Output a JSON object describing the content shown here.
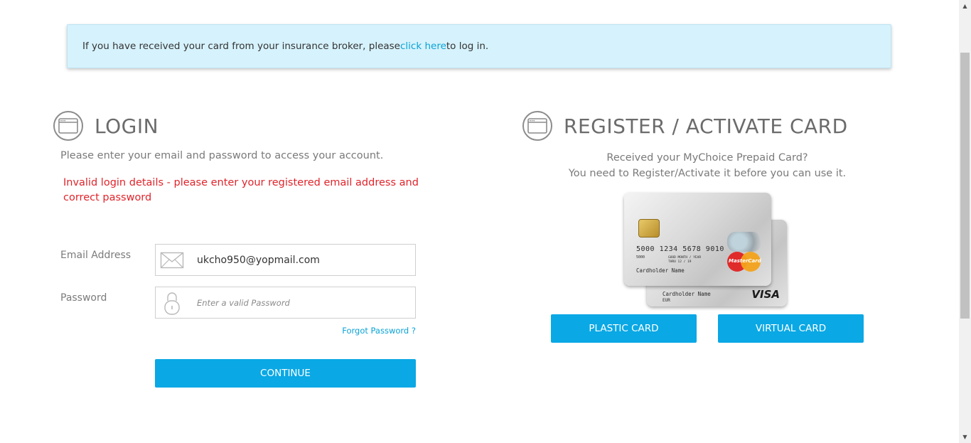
{
  "notice": {
    "before": "If you have received your card from your insurance broker, please ",
    "link": "click here",
    "after": " to log in."
  },
  "login": {
    "title": "LOGIN",
    "intro": "Please enter your email and password to access your account.",
    "error": "Invalid login details - please enter your registered email address and correct password",
    "email_label": "Email Address",
    "email_value": "ukcho950@yopmail.com",
    "password_label": "Password",
    "password_placeholder": "Enter a valid Password",
    "forgot": "Forgot Password ?",
    "continue": "CONTINUE"
  },
  "register": {
    "title": "REGISTER / ACTIVATE CARD",
    "line1": "Received your MyChoice Prepaid Card?",
    "line2": "You need to Register/Activate it before you can use it.",
    "plastic": "PLASTIC CARD",
    "virtual": "VIRTUAL CARD"
  },
  "card": {
    "number": "5000 1234 5678 9010",
    "small1": "5000",
    "valid_labels": "GOOD   MONTH / YEAR",
    "valid_thru": "THRU     12 / 19",
    "holder": "Cardholder Name",
    "currency": "EUR",
    "brand_visa": "VISA",
    "brand_mc": "MasterCard"
  },
  "colors": {
    "accent": "#0aa8e5",
    "link": "#0aa3d6",
    "error": "#e0242b",
    "notice_bg": "#d6f2fc"
  },
  "icons": {
    "login_header": "browser-window-icon",
    "register_header": "browser-window-icon",
    "email": "envelope-icon",
    "password": "padlock-icon"
  }
}
